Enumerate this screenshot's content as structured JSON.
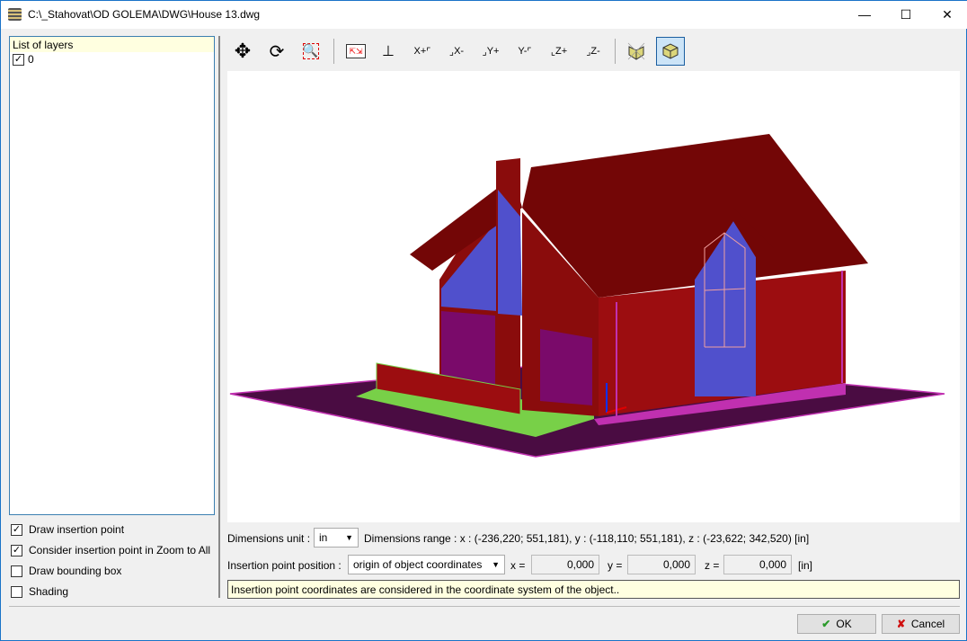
{
  "window": {
    "title": "C:\\_Stahovat\\OD GOLEMA\\DWG\\House 13.dwg",
    "app_icon": "layers-stack-icon"
  },
  "layers": {
    "header": "List of layers",
    "items": [
      {
        "name": "0",
        "checked": true
      }
    ]
  },
  "options": [
    {
      "label": "Draw insertion point",
      "checked": true
    },
    {
      "label": "Consider insertion point in Zoom to All",
      "checked": true
    },
    {
      "label": "Draw bounding box",
      "checked": false
    },
    {
      "label": "Shading",
      "checked": false
    }
  ],
  "toolbar": {
    "tools": [
      "pan",
      "rotate",
      "zoom-window",
      "zoom-all",
      "axonometric-view",
      "X+",
      "X-",
      "Y+",
      "Y-",
      "Z+",
      "Z-",
      "wireframe",
      "solid"
    ],
    "active": "solid",
    "labels": {
      "xp": "X+",
      "xm": "X-",
      "yp": "Y+",
      "ym": "Y-",
      "zp": "Z+",
      "zm": "Z-"
    }
  },
  "dimensions": {
    "unit_label": "Dimensions unit :",
    "unit": "in",
    "range_text": "Dimensions range : x : (-236,220; 551,181), y : (-118,110; 551,181), z : (-23,622; 342,520) [in]"
  },
  "insertion": {
    "label": "Insertion point position :",
    "mode": "origin of object coordinates",
    "x_label": "x =",
    "x": "0,000",
    "y_label": "y =",
    "y": "0,000",
    "z_label": "z =",
    "z": "0,000",
    "unit": "[in]"
  },
  "hint": "Insertion point coordinates are considered in the coordinate system of the object..",
  "buttons": {
    "ok": "OK",
    "cancel": "Cancel"
  },
  "colors": {
    "roof": "#730606",
    "wall": "#9c0d10",
    "glass": "#5050cc",
    "ground": "#4a0c42",
    "lawn": "#78d048",
    "trim": "#c030b0"
  }
}
